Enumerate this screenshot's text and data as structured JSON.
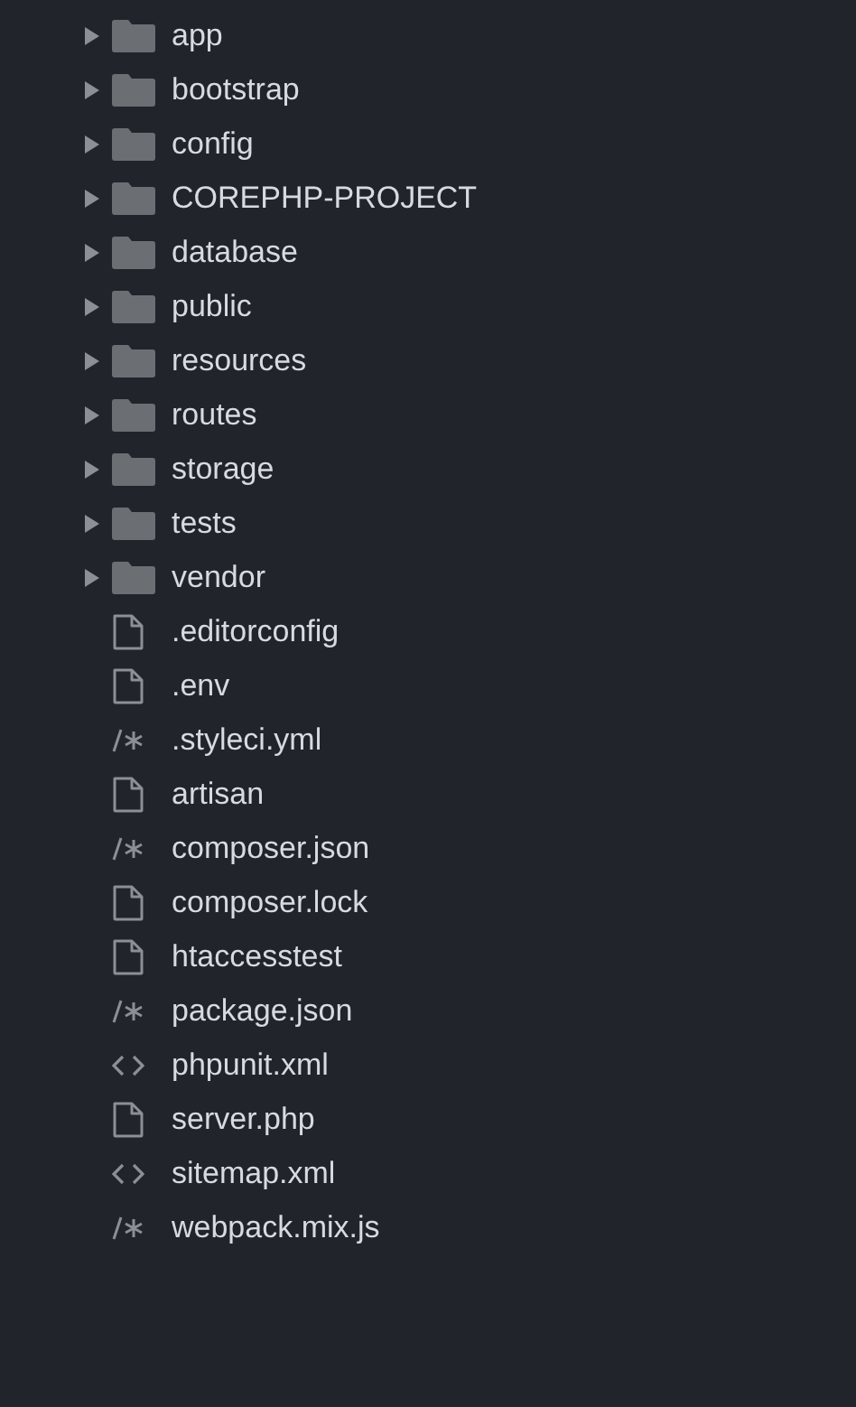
{
  "tree": [
    {
      "name": "app",
      "kind": "folder",
      "expanded": false
    },
    {
      "name": "bootstrap",
      "kind": "folder",
      "expanded": false
    },
    {
      "name": "config",
      "kind": "folder",
      "expanded": false
    },
    {
      "name": "COREPHP-PROJECT",
      "kind": "folder",
      "expanded": false
    },
    {
      "name": "database",
      "kind": "folder",
      "expanded": false
    },
    {
      "name": "public",
      "kind": "folder",
      "expanded": false
    },
    {
      "name": "resources",
      "kind": "folder",
      "expanded": false
    },
    {
      "name": "routes",
      "kind": "folder",
      "expanded": false
    },
    {
      "name": "storage",
      "kind": "folder",
      "expanded": false
    },
    {
      "name": "tests",
      "kind": "folder",
      "expanded": false
    },
    {
      "name": "vendor",
      "kind": "folder",
      "expanded": false
    },
    {
      "name": ".editorconfig",
      "kind": "file"
    },
    {
      "name": ".env",
      "kind": "file"
    },
    {
      "name": ".styleci.yml",
      "kind": "config"
    },
    {
      "name": "artisan",
      "kind": "file"
    },
    {
      "name": "composer.json",
      "kind": "config"
    },
    {
      "name": "composer.lock",
      "kind": "file"
    },
    {
      "name": "htaccesstest",
      "kind": "file"
    },
    {
      "name": "package.json",
      "kind": "config"
    },
    {
      "name": "phpunit.xml",
      "kind": "markup"
    },
    {
      "name": "server.php",
      "kind": "file"
    },
    {
      "name": "sitemap.xml",
      "kind": "markup"
    },
    {
      "name": "webpack.mix.js",
      "kind": "config"
    }
  ]
}
